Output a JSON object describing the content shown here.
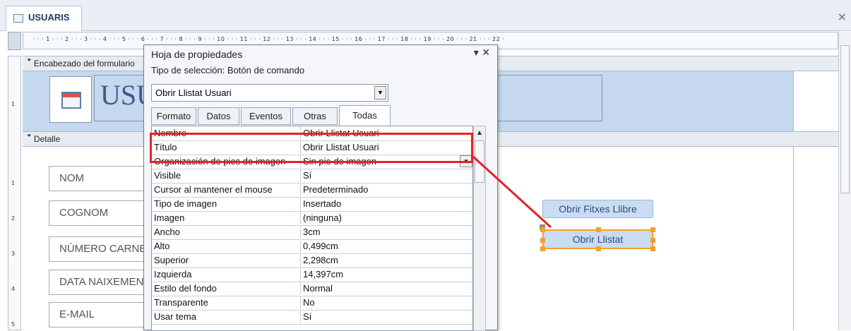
{
  "tab": {
    "label": "USUARIS",
    "close_glyph": "×"
  },
  "ruler": {
    "h_text": "· · · 1 · · · 2 · · · 3 · · · 4 · · · 5 · · · 6 · · · 7 · · · 8 · · · 9 · · · 10 · · · 11 · · · 12 · · · 13 · · · 14 · · · 15 · · · 16 · · · 17 · · · 18 · · · 19 · · · 20 · · · 21 · · · 22 ·",
    "v_labels": [
      "1",
      "1",
      "2",
      "3",
      "4",
      "5"
    ]
  },
  "sections": {
    "header_label": "Encabezado del formulario",
    "detail_label": "Detalle"
  },
  "form": {
    "title": "USUARIS",
    "fields": [
      "NOM",
      "COGNOM",
      "NÚMERO CARNET",
      "DATA NAIXEMENT",
      "E-MAIL"
    ],
    "buttons": {
      "fitxes": "Obrir Fitxes Llibre",
      "llistat": "Obrir Llistat"
    }
  },
  "property_sheet": {
    "title": "Hoja de propiedades",
    "controls": "▾ ✕",
    "selection_type": "Tipo de selección:  Botón de comando",
    "combo_value": "Obrir Llistat Usuari",
    "tabs": [
      "Formato",
      "Datos",
      "Eventos",
      "Otras",
      "Todas"
    ],
    "active_tab": "Todas",
    "rows": [
      {
        "name": "Nombre",
        "value": "Obrir Llistat Usuari"
      },
      {
        "name": "Título",
        "value": "Obrir Llistat Usuari"
      },
      {
        "name": "Organización de pies de imagen",
        "value": "Sin pie de imagen"
      },
      {
        "name": "Visible",
        "value": "Sí"
      },
      {
        "name": "Cursor al mantener el mouse",
        "value": "Predeterminado"
      },
      {
        "name": "Tipo de imagen",
        "value": "Insertado"
      },
      {
        "name": "Imagen",
        "value": "(ninguna)"
      },
      {
        "name": "Ancho",
        "value": "3cm"
      },
      {
        "name": "Alto",
        "value": "0,499cm"
      },
      {
        "name": "Superior",
        "value": "2,298cm"
      },
      {
        "name": "Izquierda",
        "value": "14,397cm"
      },
      {
        "name": "Estilo del fondo",
        "value": "Normal"
      },
      {
        "name": "Transparente",
        "value": "No"
      },
      {
        "name": "Usar tema",
        "value": "Sí"
      }
    ]
  },
  "colors": {
    "highlight": "#e02428",
    "selection": "#f5a02a",
    "header_background": "#c6d8ee"
  }
}
